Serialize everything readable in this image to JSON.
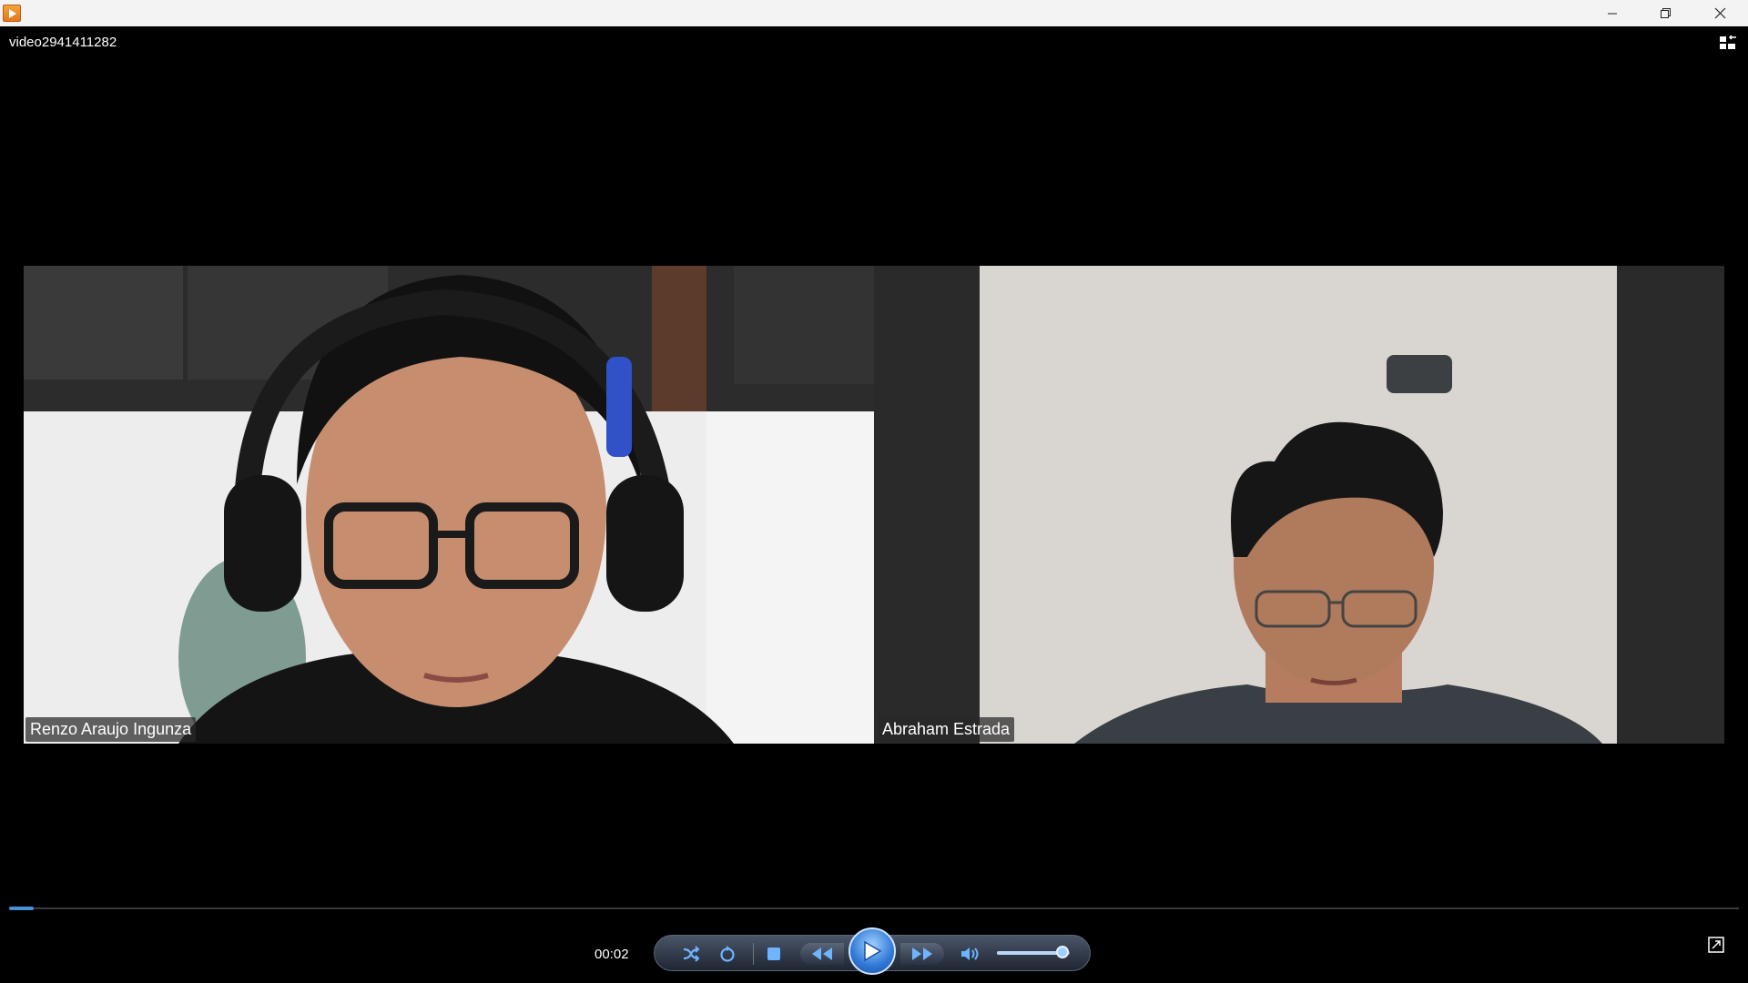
{
  "window": {
    "title": "video2941411282",
    "controls": [
      "minimize-icon",
      "restore-icon",
      "close-icon"
    ]
  },
  "participants": [
    {
      "name": "Renzo Araujo Ingunza"
    },
    {
      "name": "Abraham Estrada"
    }
  ],
  "player": {
    "current_time": "00:02",
    "progress_fraction": 0.014,
    "volume_fraction": 0.9,
    "state": "paused",
    "buttons": [
      "shuffle-icon",
      "repeat-icon",
      "stop-icon",
      "previous-icon",
      "play-icon",
      "next-icon",
      "volume-icon",
      "miniplayer-icon",
      "layout-icon"
    ]
  },
  "colors": {
    "accent": "#2f78d6",
    "background": "#000000"
  }
}
